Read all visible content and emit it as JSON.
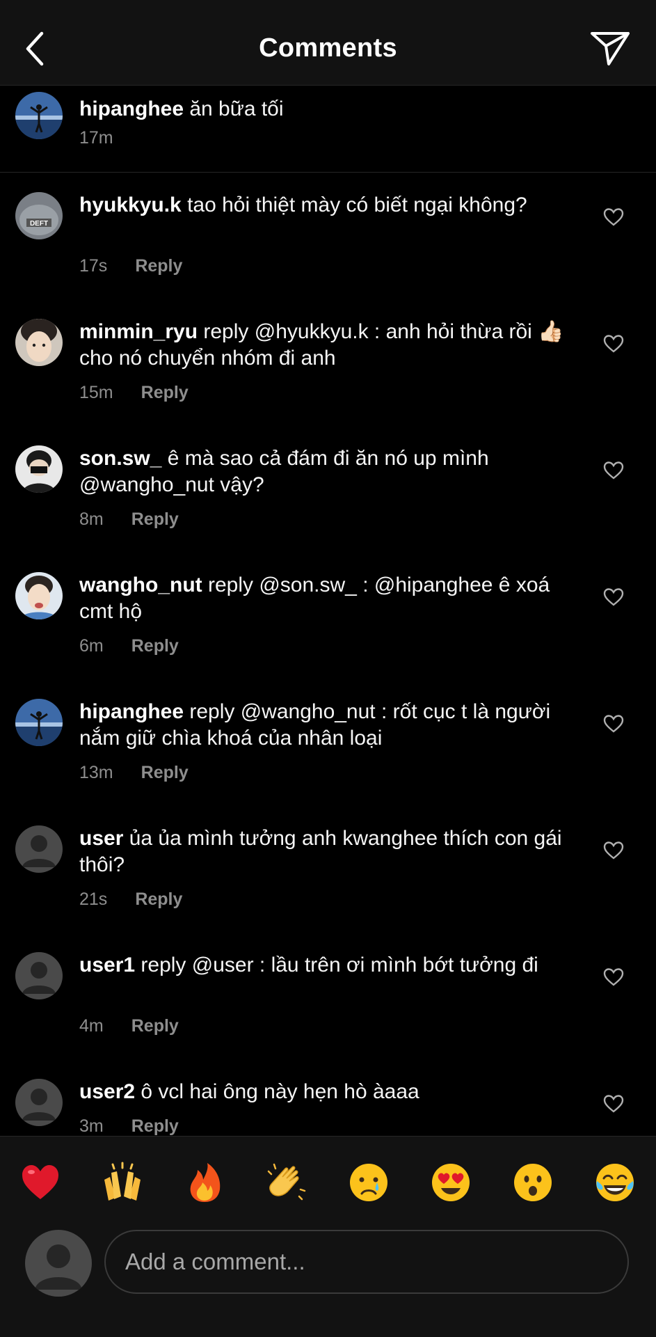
{
  "header": {
    "title": "Comments"
  },
  "caption": {
    "user": "hipanghee",
    "text": " ăn bữa tối",
    "time": "17m"
  },
  "comments": [
    {
      "user": "hyukkyu.k",
      "text": " tao hỏi thiệt mày có biết ngại không?",
      "time": "17s",
      "reply": "Reply"
    },
    {
      "user": "minmin_ryu",
      "text": " reply @hyukkyu.k : anh hỏi thừa rồi 👍🏻 cho nó chuyển nhóm đi anh",
      "time": "15m",
      "reply": "Reply"
    },
    {
      "user": "son.sw_",
      "text": " ê mà sao cả đám đi ăn nó up mình @wangho_nut vậy?",
      "time": "8m",
      "reply": "Reply"
    },
    {
      "user": "wangho_nut",
      "text": " reply @son.sw_ : @hipanghee ê xoá cmt hộ",
      "time": "6m",
      "reply": "Reply"
    },
    {
      "user": "hipanghee",
      "text": " reply @wangho_nut : rốt cục t là người nắm giữ chìa khoá của nhân loại",
      "time": "13m",
      "reply": "Reply"
    },
    {
      "user": "user",
      "text": " ủa ủa mình tưởng anh kwanghee thích con gái thôi?",
      "time": "21s",
      "reply": "Reply"
    },
    {
      "user": "user1",
      "text": " reply @user : lầu trên ơi mình bớt tưởng đi",
      "time": "4m",
      "reply": "Reply"
    },
    {
      "user": "user2",
      "text": " ô vcl hai ông này hẹn hò àaaa",
      "time": "3m",
      "reply": "Reply"
    }
  ],
  "quick_reactions": [
    "heart",
    "raising-hands",
    "fire",
    "clapping-hands",
    "crying-face",
    "heart-eyes-face",
    "astonished-face",
    "tears-of-joy-face"
  ],
  "composer": {
    "placeholder": "Add a comment..."
  }
}
